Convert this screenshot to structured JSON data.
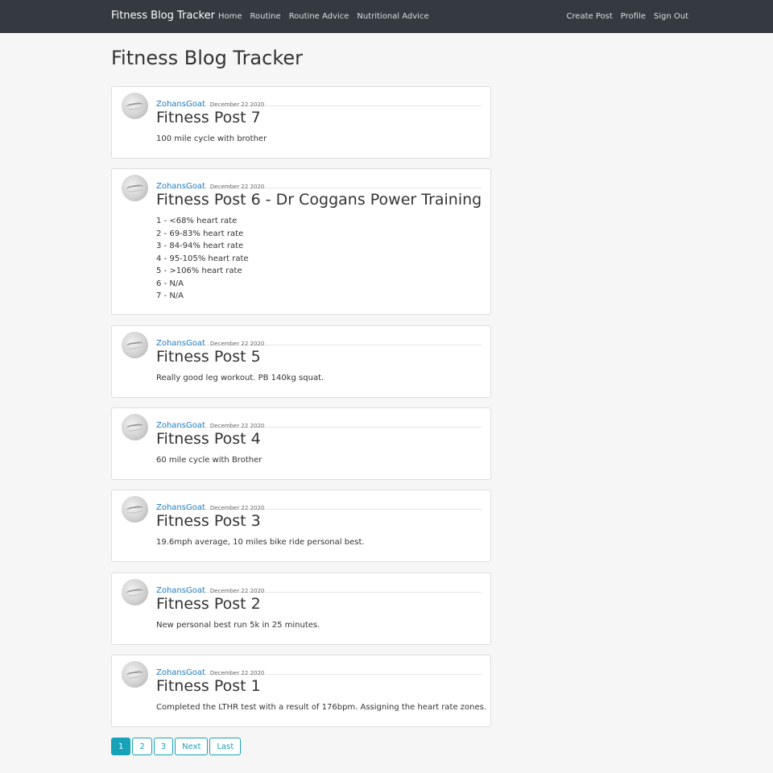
{
  "nav": {
    "brand": "Fitness Blog Tracker",
    "left": [
      "Home",
      "Routine",
      "Routine Advice",
      "Nutritional Advice"
    ],
    "right": [
      "Create Post",
      "Profile",
      "Sign Out"
    ]
  },
  "page": {
    "title": "Fitness Blog Tracker"
  },
  "posts": [
    {
      "author": "ZohansGoat",
      "date": "December 22 2020",
      "title": "Fitness Post 7",
      "lines": [
        "100 mile cycle with brother"
      ]
    },
    {
      "author": "ZohansGoat",
      "date": "December 22 2020",
      "title": "Fitness Post 6 - Dr Coggans Power Training",
      "lines": [
        "1 - <68% heart rate",
        "2 - 69-83% heart rate",
        "3 - 84-94% heart rate",
        "4 - 95-105% heart rate",
        "5 - >106% heart rate",
        "6 - N/A",
        "7 - N/A"
      ]
    },
    {
      "author": "ZohansGoat",
      "date": "December 22 2020",
      "title": "Fitness Post 5",
      "lines": [
        "Really good leg workout. PB 140kg squat."
      ]
    },
    {
      "author": "ZohansGoat",
      "date": "December 22 2020",
      "title": "Fitness Post 4",
      "lines": [
        "60 mile cycle with Brother"
      ]
    },
    {
      "author": "ZohansGoat",
      "date": "December 22 2020",
      "title": "Fitness Post 3",
      "lines": [
        "19.6mph average, 10 miles bike ride personal best."
      ]
    },
    {
      "author": "ZohansGoat",
      "date": "December 22 2020",
      "title": "Fitness Post 2",
      "lines": [
        "New personal best run 5k in 25 minutes."
      ]
    },
    {
      "author": "ZohansGoat",
      "date": "December 22 2020",
      "title": "Fitness Post 1",
      "lines": [
        "Completed the LTHR test with a result of 176bpm. Assigning the heart rate zones."
      ]
    }
  ],
  "pagination": {
    "pages": [
      "1",
      "2",
      "3"
    ],
    "next": "Next",
    "last": "Last",
    "current": "1"
  }
}
